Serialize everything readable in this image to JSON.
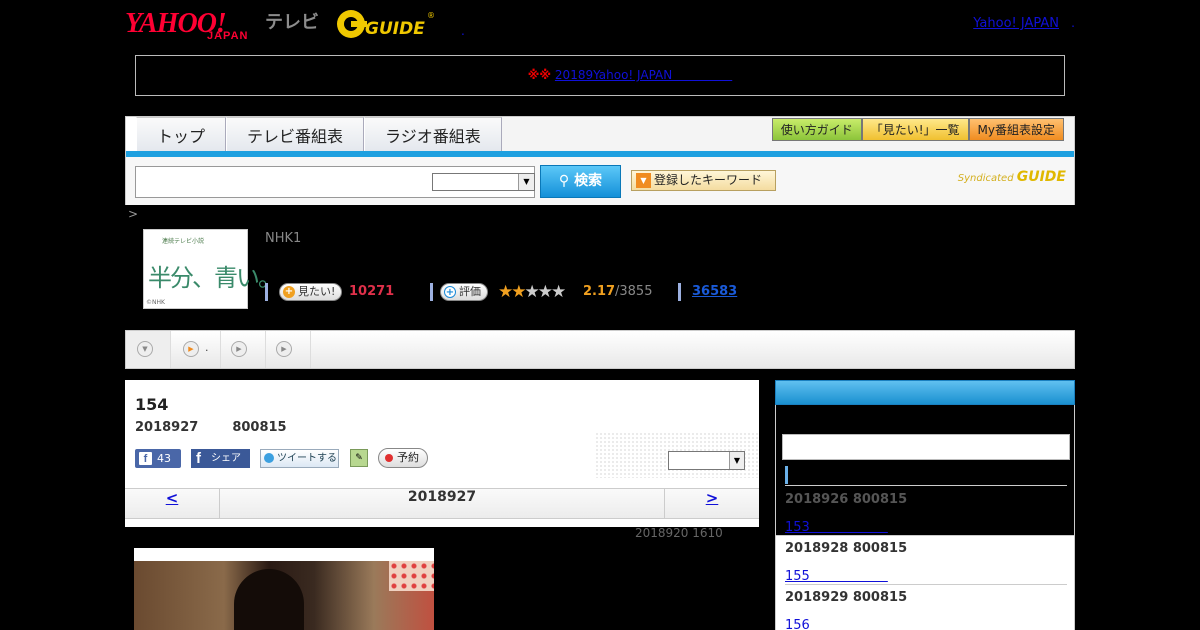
{
  "header": {
    "logo_text": "YAHOO!",
    "logo_sub": "JAPAN",
    "tv_label": "テレビ",
    "gguide_label": "G-GUIDE",
    "dot": ".",
    "yj_link": "Yahoo! JAPAN",
    "yj_dot": "."
  },
  "notice": {
    "mark": "※※",
    "link": "20189Yahoo! JAPAN　　　　　"
  },
  "nav": {
    "tabs": [
      "トップ",
      "テレビ番組表",
      "ラジオ番組表"
    ],
    "right_buttons": [
      "使い方ガイド",
      "「見たい!」一覧",
      "My番組表設定"
    ],
    "search_button": "検索",
    "keyword_button": "登録したキーワード",
    "syndicated": "Syndicated",
    "syndicated_brand": "GUIDE"
  },
  "breadcrumb": ">",
  "program": {
    "image_small": "連続テレビ小説",
    "image_title": "半分、青い。",
    "image_credit": "©NHK",
    "channel": "NHK1",
    "want_label": "見たい!",
    "want_count": "10271",
    "rate_label": "評価",
    "stars_on": 2,
    "stars_total": 5,
    "rating": "2.17",
    "rating_count": "/3855",
    "reviews": "36583"
  },
  "tabstrip": {
    "dot": "."
  },
  "episode": {
    "title": "154",
    "date": "2018927",
    "time": "800815",
    "fb_like_count": "43",
    "fb_share": "シェア",
    "tweet": "ツイートする",
    "reserve": "予約",
    "pager_prev": "<",
    "pager_date": "2018927",
    "pager_next": ">",
    "updated": "2018920  1610"
  },
  "sidebar": {
    "items": [
      {
        "date": "2018926  800815",
        "title": "153　　　　　　"
      },
      {
        "date": "2018928  800815",
        "title": "155　　　　　　"
      },
      {
        "date": "2018929  800815",
        "title": "156　　　　　　"
      }
    ]
  }
}
